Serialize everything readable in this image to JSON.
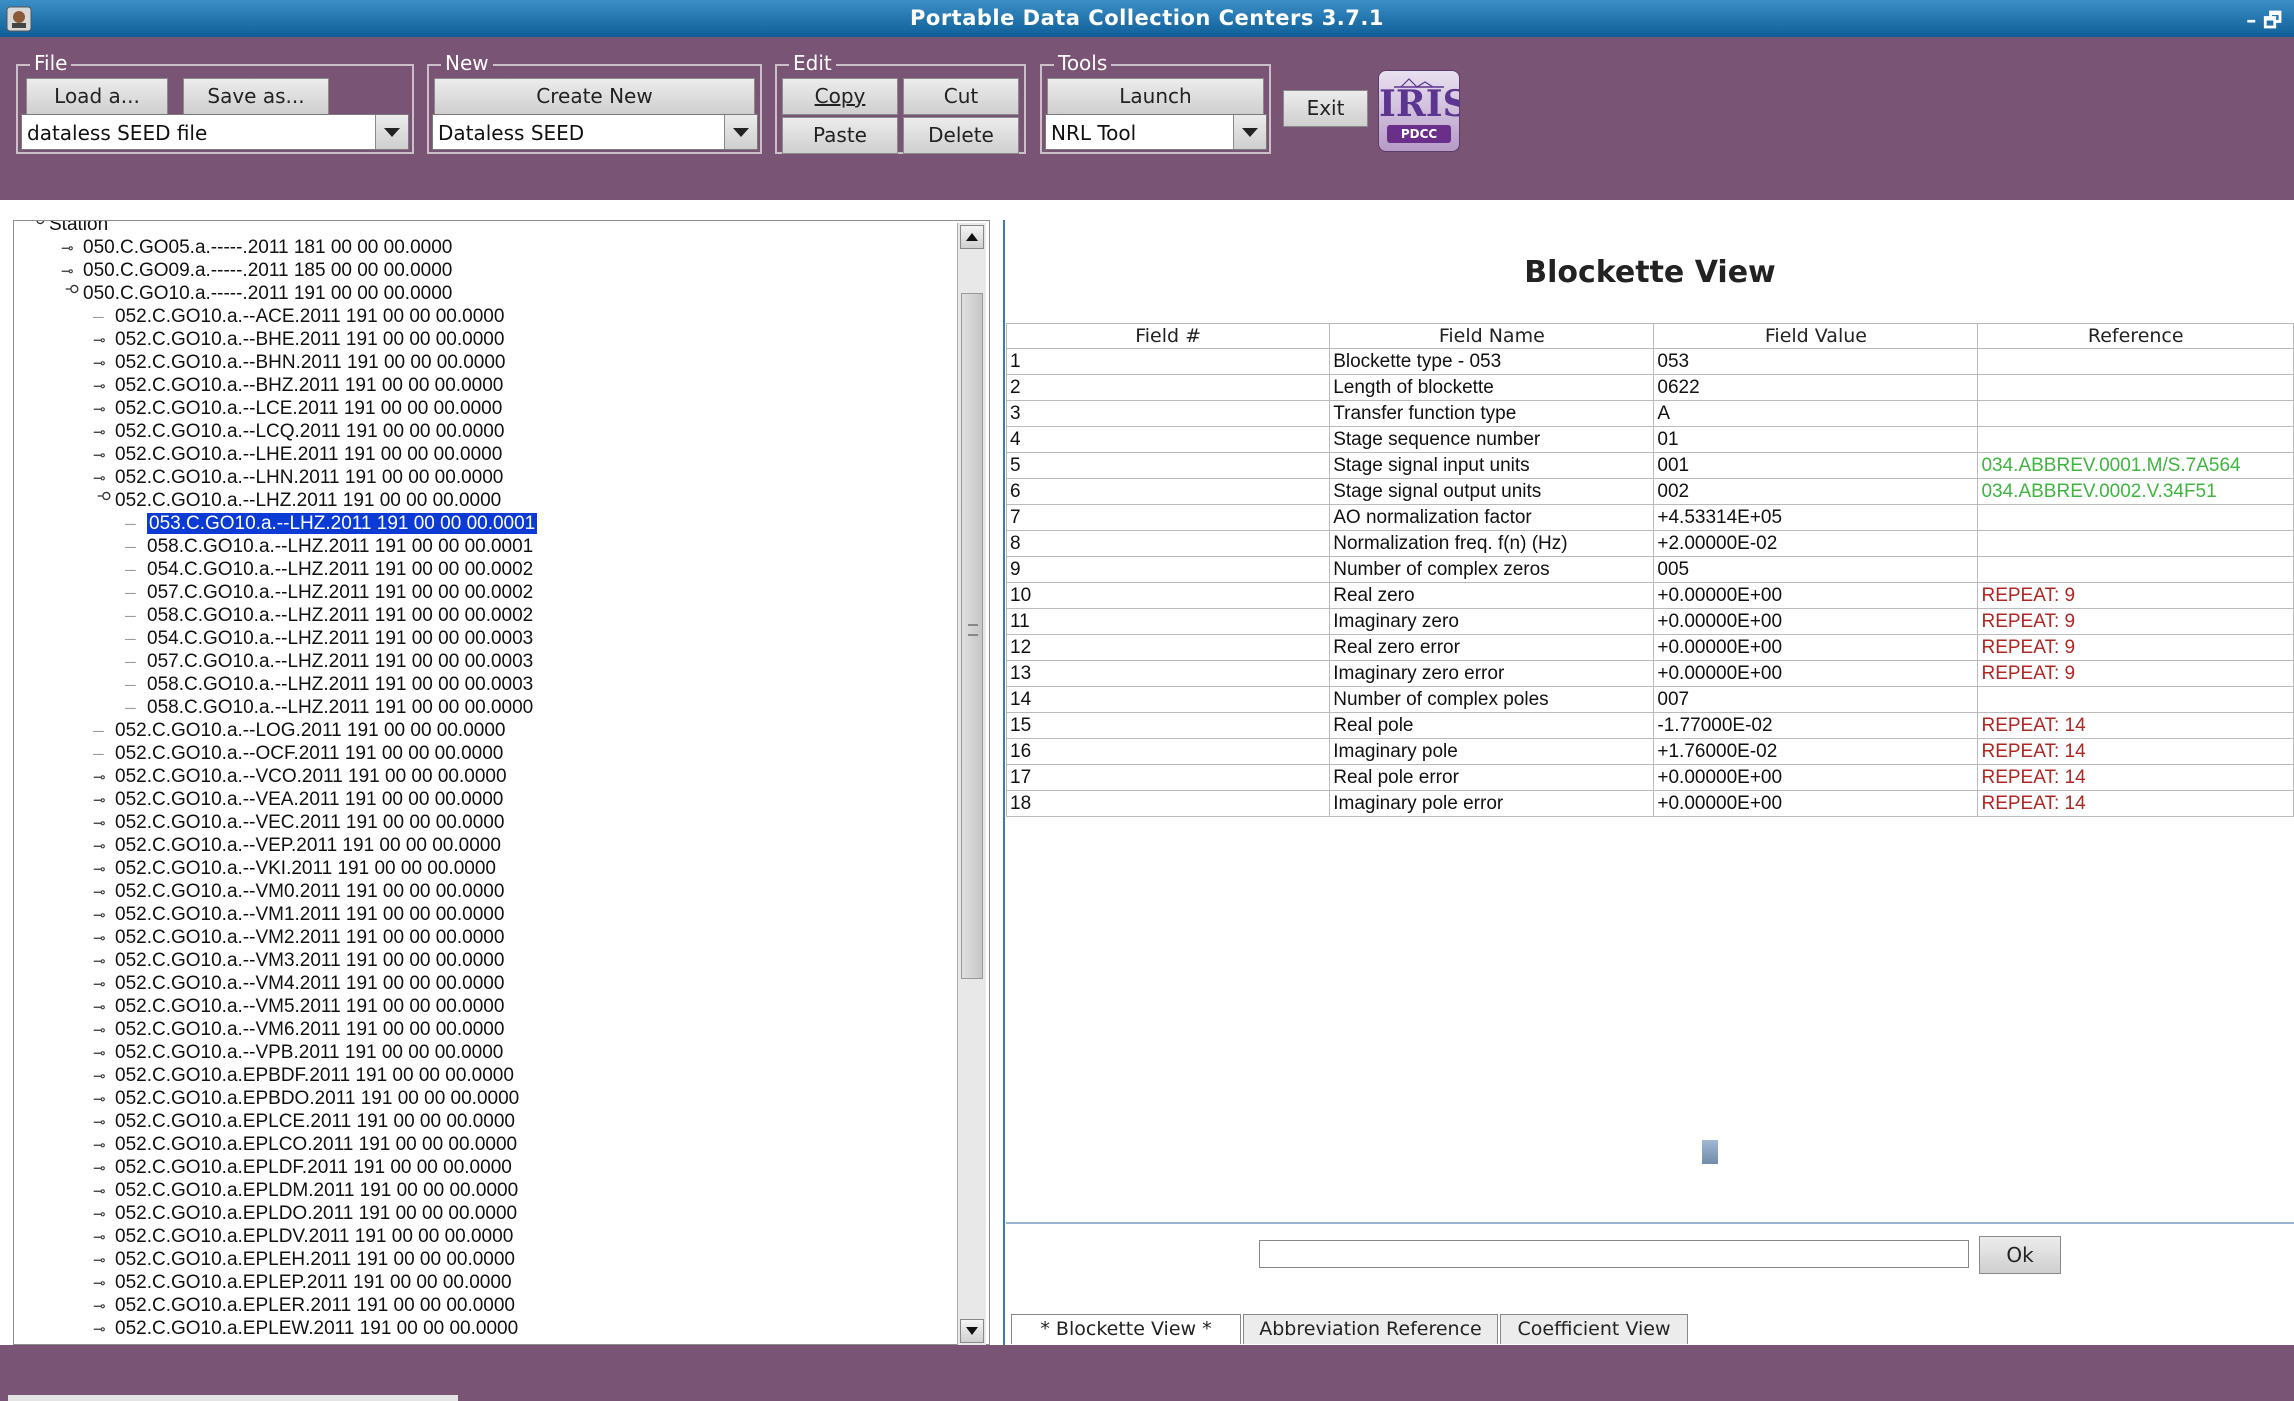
{
  "window": {
    "title": "Portable Data Collection Centers 3.7.1",
    "controls": "– 🗗"
  },
  "toolbar": {
    "file": {
      "label": "File",
      "load": "Load a...",
      "save": "Save as...",
      "combo": "dataless SEED file"
    },
    "new": {
      "label": "New",
      "create": "Create New",
      "combo": "Dataless SEED"
    },
    "edit": {
      "label": "Edit",
      "copy": "Copy",
      "cut": "Cut",
      "paste": "Paste",
      "delete": "Delete"
    },
    "tools": {
      "label": "Tools",
      "launch": "Launch",
      "combo": "NRL Tool"
    },
    "exit": "Exit",
    "logo": {
      "text": "IRIS",
      "sub": "PDCC"
    }
  },
  "tree": {
    "rows": [
      {
        "label": "Station",
        "handle": "expanded",
        "level": 0
      },
      {
        "label": "050.C.GO05.a.-----.2011 181 00 00 00.0000",
        "handle": "collapsed",
        "level": 1
      },
      {
        "label": "050.C.GO09.a.-----.2011 185 00 00 00.0000",
        "handle": "collapsed",
        "level": 1
      },
      {
        "label": "050.C.GO10.a.-----.2011 191 00 00 00.0000",
        "handle": "expanded",
        "level": 1
      },
      {
        "label": "052.C.GO10.a.--ACE.2011 191 00 00 00.0000",
        "handle": "leaf",
        "level": 2
      },
      {
        "label": "052.C.GO10.a.--BHE.2011 191 00 00 00.0000",
        "handle": "collapsed",
        "level": 2
      },
      {
        "label": "052.C.GO10.a.--BHN.2011 191 00 00 00.0000",
        "handle": "collapsed",
        "level": 2
      },
      {
        "label": "052.C.GO10.a.--BHZ.2011 191 00 00 00.0000",
        "handle": "collapsed",
        "level": 2
      },
      {
        "label": "052.C.GO10.a.--LCE.2011 191 00 00 00.0000",
        "handle": "collapsed",
        "level": 2
      },
      {
        "label": "052.C.GO10.a.--LCQ.2011 191 00 00 00.0000",
        "handle": "collapsed",
        "level": 2
      },
      {
        "label": "052.C.GO10.a.--LHE.2011 191 00 00 00.0000",
        "handle": "collapsed",
        "level": 2
      },
      {
        "label": "052.C.GO10.a.--LHN.2011 191 00 00 00.0000",
        "handle": "collapsed",
        "level": 2
      },
      {
        "label": "052.C.GO10.a.--LHZ.2011 191 00 00 00.0000",
        "handle": "expanded",
        "level": 2
      },
      {
        "label": "053.C.GO10.a.--LHZ.2011 191 00 00 00.0001",
        "handle": "leaf",
        "level": 3,
        "selected": true
      },
      {
        "label": "058.C.GO10.a.--LHZ.2011 191 00 00 00.0001",
        "handle": "leaf",
        "level": 3
      },
      {
        "label": "054.C.GO10.a.--LHZ.2011 191 00 00 00.0002",
        "handle": "leaf",
        "level": 3
      },
      {
        "label": "057.C.GO10.a.--LHZ.2011 191 00 00 00.0002",
        "handle": "leaf",
        "level": 3
      },
      {
        "label": "058.C.GO10.a.--LHZ.2011 191 00 00 00.0002",
        "handle": "leaf",
        "level": 3
      },
      {
        "label": "054.C.GO10.a.--LHZ.2011 191 00 00 00.0003",
        "handle": "leaf",
        "level": 3
      },
      {
        "label": "057.C.GO10.a.--LHZ.2011 191 00 00 00.0003",
        "handle": "leaf",
        "level": 3
      },
      {
        "label": "058.C.GO10.a.--LHZ.2011 191 00 00 00.0003",
        "handle": "leaf",
        "level": 3
      },
      {
        "label": "058.C.GO10.a.--LHZ.2011 191 00 00 00.0000",
        "handle": "leaf",
        "level": 3
      },
      {
        "label": "052.C.GO10.a.--LOG.2011 191 00 00 00.0000",
        "handle": "leaf",
        "level": 2
      },
      {
        "label": "052.C.GO10.a.--OCF.2011 191 00 00 00.0000",
        "handle": "leaf",
        "level": 2
      },
      {
        "label": "052.C.GO10.a.--VCO.2011 191 00 00 00.0000",
        "handle": "collapsed",
        "level": 2
      },
      {
        "label": "052.C.GO10.a.--VEA.2011 191 00 00 00.0000",
        "handle": "collapsed",
        "level": 2
      },
      {
        "label": "052.C.GO10.a.--VEC.2011 191 00 00 00.0000",
        "handle": "collapsed",
        "level": 2
      },
      {
        "label": "052.C.GO10.a.--VEP.2011 191 00 00 00.0000",
        "handle": "collapsed",
        "level": 2
      },
      {
        "label": "052.C.GO10.a.--VKI.2011 191 00 00 00.0000",
        "handle": "collapsed",
        "level": 2
      },
      {
        "label": "052.C.GO10.a.--VM0.2011 191 00 00 00.0000",
        "handle": "collapsed",
        "level": 2
      },
      {
        "label": "052.C.GO10.a.--VM1.2011 191 00 00 00.0000",
        "handle": "collapsed",
        "level": 2
      },
      {
        "label": "052.C.GO10.a.--VM2.2011 191 00 00 00.0000",
        "handle": "collapsed",
        "level": 2
      },
      {
        "label": "052.C.GO10.a.--VM3.2011 191 00 00 00.0000",
        "handle": "collapsed",
        "level": 2
      },
      {
        "label": "052.C.GO10.a.--VM4.2011 191 00 00 00.0000",
        "handle": "collapsed",
        "level": 2
      },
      {
        "label": "052.C.GO10.a.--VM5.2011 191 00 00 00.0000",
        "handle": "collapsed",
        "level": 2
      },
      {
        "label": "052.C.GO10.a.--VM6.2011 191 00 00 00.0000",
        "handle": "collapsed",
        "level": 2
      },
      {
        "label": "052.C.GO10.a.--VPB.2011 191 00 00 00.0000",
        "handle": "collapsed",
        "level": 2
      },
      {
        "label": "052.C.GO10.a.EPBDF.2011 191 00 00 00.0000",
        "handle": "collapsed",
        "level": 2
      },
      {
        "label": "052.C.GO10.a.EPBDO.2011 191 00 00 00.0000",
        "handle": "collapsed",
        "level": 2
      },
      {
        "label": "052.C.GO10.a.EPLCE.2011 191 00 00 00.0000",
        "handle": "collapsed",
        "level": 2
      },
      {
        "label": "052.C.GO10.a.EPLCO.2011 191 00 00 00.0000",
        "handle": "collapsed",
        "level": 2
      },
      {
        "label": "052.C.GO10.a.EPLDF.2011 191 00 00 00.0000",
        "handle": "collapsed",
        "level": 2
      },
      {
        "label": "052.C.GO10.a.EPLDM.2011 191 00 00 00.0000",
        "handle": "collapsed",
        "level": 2
      },
      {
        "label": "052.C.GO10.a.EPLDO.2011 191 00 00 00.0000",
        "handle": "collapsed",
        "level": 2
      },
      {
        "label": "052.C.GO10.a.EPLDV.2011 191 00 00 00.0000",
        "handle": "collapsed",
        "level": 2
      },
      {
        "label": "052.C.GO10.a.EPLEH.2011 191 00 00 00.0000",
        "handle": "collapsed",
        "level": 2
      },
      {
        "label": "052.C.GO10.a.EPLEP.2011 191 00 00 00.0000",
        "handle": "collapsed",
        "level": 2
      },
      {
        "label": "052.C.GO10.a.EPLER.2011 191 00 00 00.0000",
        "handle": "collapsed",
        "level": 2
      },
      {
        "label": "052.C.GO10.a.EPLEW.2011 191 00 00 00.0000",
        "handle": "collapsed",
        "level": 2
      }
    ]
  },
  "blockette_view": {
    "title": "Blockette View",
    "headers": [
      "Field #",
      "Field Name",
      "Field Value",
      "Reference"
    ],
    "rows": [
      {
        "num": "1",
        "name": "Blockette type - 053",
        "value": "053",
        "ref": "",
        "ref_type": ""
      },
      {
        "num": "2",
        "name": "Length of blockette",
        "value": "0622",
        "ref": "",
        "ref_type": ""
      },
      {
        "num": "3",
        "name": "Transfer function type",
        "value": "A",
        "ref": "",
        "ref_type": ""
      },
      {
        "num": "4",
        "name": "Stage sequence number",
        "value": "01",
        "ref": "",
        "ref_type": ""
      },
      {
        "num": "5",
        "name": "Stage signal input units",
        "value": "001",
        "ref": "034.ABBREV.0001.M/S.7A564",
        "ref_type": "link"
      },
      {
        "num": "6",
        "name": "Stage signal output units",
        "value": "002",
        "ref": "034.ABBREV.0002.V.34F51",
        "ref_type": "link"
      },
      {
        "num": "7",
        "name": "AO normalization factor",
        "value": "+4.53314E+05",
        "ref": "",
        "ref_type": ""
      },
      {
        "num": "8",
        "name": "Normalization freq. f(n) (Hz)",
        "value": "+2.00000E-02",
        "ref": "",
        "ref_type": ""
      },
      {
        "num": "9",
        "name": "Number of complex zeros",
        "value": "005",
        "ref": "",
        "ref_type": ""
      },
      {
        "num": "10",
        "name": "Real zero",
        "value": "+0.00000E+00",
        "ref": "REPEAT: 9",
        "ref_type": "repeat"
      },
      {
        "num": "11",
        "name": "Imaginary zero",
        "value": "+0.00000E+00",
        "ref": "REPEAT: 9",
        "ref_type": "repeat"
      },
      {
        "num": "12",
        "name": "Real zero error",
        "value": "+0.00000E+00",
        "ref": "REPEAT: 9",
        "ref_type": "repeat"
      },
      {
        "num": "13",
        "name": "Imaginary zero error",
        "value": "+0.00000E+00",
        "ref": "REPEAT: 9",
        "ref_type": "repeat"
      },
      {
        "num": "14",
        "name": "Number of complex poles",
        "value": "007",
        "ref": "",
        "ref_type": ""
      },
      {
        "num": "15",
        "name": "Real pole",
        "value": "-1.77000E-02",
        "ref": "REPEAT: 14",
        "ref_type": "repeat"
      },
      {
        "num": "16",
        "name": "Imaginary pole",
        "value": "+1.76000E-02",
        "ref": "REPEAT: 14",
        "ref_type": "repeat"
      },
      {
        "num": "17",
        "name": "Real pole error",
        "value": "+0.00000E+00",
        "ref": "REPEAT: 14",
        "ref_type": "repeat"
      },
      {
        "num": "18",
        "name": "Imaginary pole error",
        "value": "+0.00000E+00",
        "ref": "REPEAT: 14",
        "ref_type": "repeat"
      }
    ]
  },
  "message": {
    "input_value": "",
    "ok": "Ok"
  },
  "tabs": [
    {
      "label": "* Blockette View *",
      "active": true
    },
    {
      "label": "Abbreviation Reference",
      "active": false
    },
    {
      "label": "Coefficient View",
      "active": false
    }
  ],
  "colors": {
    "toolbar_bg": "#7a5475",
    "titlebar": "#1a6aa6",
    "selection": "#0b3bd4",
    "reference_link": "#3fb540",
    "reference_repeat": "#b02622"
  },
  "icons": {
    "app": "app-icon",
    "tree_expanded": "node-expanded-icon",
    "tree_collapsed": "node-collapsed-icon",
    "scroll_up": "scroll-up-arrow-icon",
    "scroll_down": "scroll-down-arrow-icon",
    "combo_arrow": "chevron-down-icon"
  }
}
